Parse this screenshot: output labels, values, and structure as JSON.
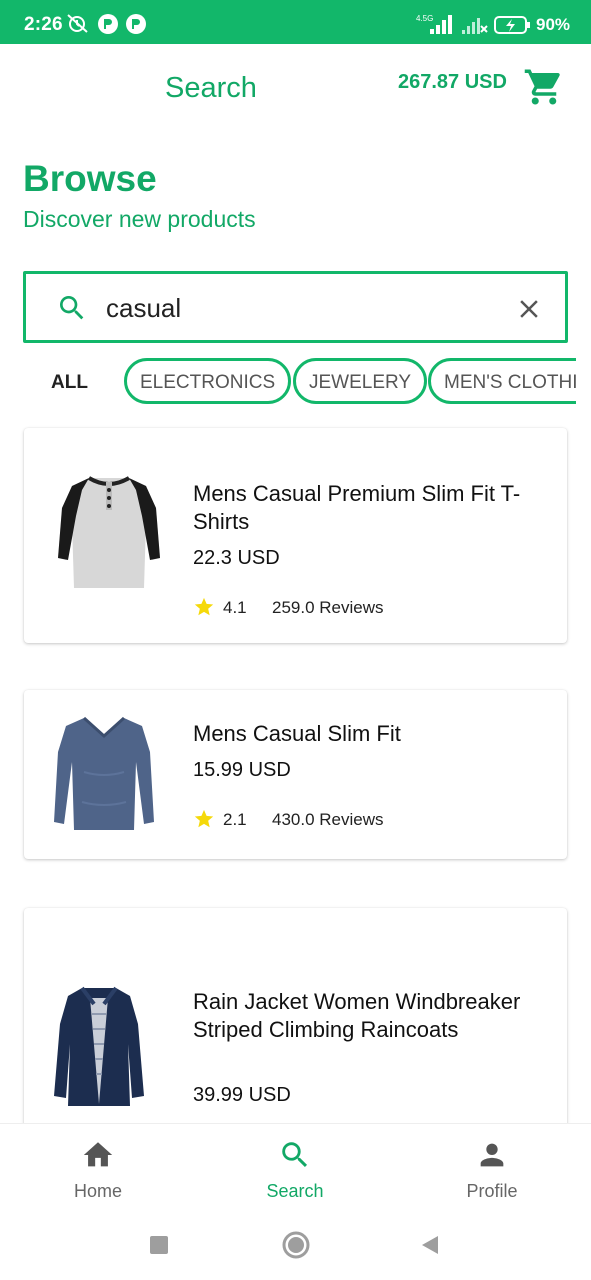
{
  "status_bar": {
    "time": "2:26",
    "network_label": "4.5G",
    "battery": "90%"
  },
  "header": {
    "title": "Search",
    "cart_total": "267.87 USD",
    "cart_icon": "cart-icon"
  },
  "browse": {
    "title": "Browse",
    "subtitle": "Discover new products"
  },
  "search": {
    "value": "casual",
    "placeholder": ""
  },
  "categories": {
    "all": "ALL",
    "items": [
      "ELECTRONICS",
      "JEWELERY",
      "MEN'S CLOTHING"
    ]
  },
  "products": [
    {
      "name": "Mens Casual Premium Slim Fit T-Shirts",
      "price": "22.3 USD",
      "rating": "4.1",
      "reviews": "259.0 Reviews"
    },
    {
      "name": "Mens Casual Slim Fit",
      "price": "15.99 USD",
      "rating": "2.1",
      "reviews": "430.0 Reviews"
    },
    {
      "name": "Rain Jacket Women Windbreaker Striped Climbing Raincoats",
      "price": "39.99 USD"
    }
  ],
  "bottom_nav": {
    "items": [
      {
        "label": "Home",
        "icon": "home-icon"
      },
      {
        "label": "Search",
        "icon": "search-icon"
      },
      {
        "label": "Profile",
        "icon": "person-icon"
      }
    ],
    "active": "Search"
  },
  "colors": {
    "accent": "#12b76a",
    "accent_text": "#12a866",
    "star": "#f5d90a"
  }
}
